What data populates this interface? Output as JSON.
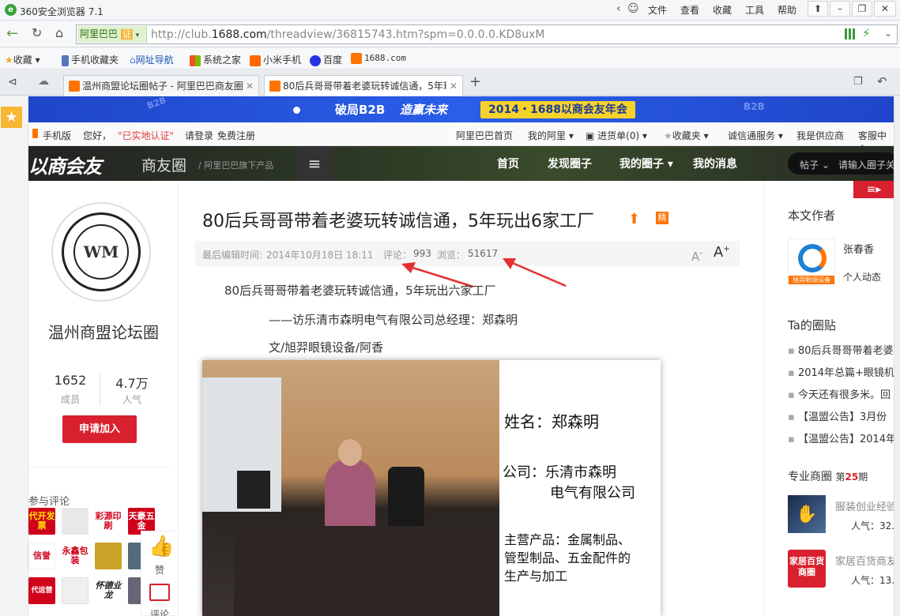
{
  "browser": {
    "title": "360安全浏览器 7.1",
    "menu": [
      "文件",
      "查看",
      "收藏",
      "工具",
      "帮助"
    ],
    "address_prefix": "http://club.",
    "address_domain": "1688.com",
    "address_rest": "/threadview/36815743.htm?spm=0.0.0.0.KD8uxM",
    "site_badge": "阿里巴巴",
    "site_cert": "证",
    "favorites": [
      "收藏",
      "手机收藏夹",
      "网址导航",
      "系统之家",
      "小米手机",
      "百度",
      "1688.com"
    ],
    "tabs": [
      {
        "label": "温州商盟论坛圈帖子 - 阿里巴巴商友圈"
      },
      {
        "label": "80后兵哥哥带着老婆玩转诚信通，5年玩出6家工厂"
      }
    ]
  },
  "banner": {
    "left": "破局B2B",
    "mid": "造赢未来",
    "right": "2014・1688以商会友年会",
    "tag": "B2B"
  },
  "topnav": {
    "mobile": "手机版",
    "hello": "您好，",
    "cert": "\"已实地认证\"",
    "login": "请登录",
    "register": "免费注册",
    "links": [
      "阿里巴巴首页",
      "我的阿里",
      "进货单(0)",
      "收藏夹",
      "诚信通服务",
      "我是供应商",
      "客服中心"
    ]
  },
  "mainnav": {
    "logo": "以商会友",
    "brand": "商友圈",
    "sub": "/ 阿里巴巴旗下产品",
    "links": [
      "首页",
      "发现圈子",
      "我的圈子",
      "我的消息"
    ],
    "search_scope": "帖子",
    "search_placeholder": "请输入圈子关"
  },
  "circle": {
    "name": "温州商盟论坛圈",
    "members": "1652",
    "members_label": "成员",
    "popularity": "4.7万",
    "popularity_label": "人气",
    "join": "申请加入",
    "participants": "参与评论",
    "badges": [
      "代开发票",
      "",
      "彩源印刷",
      "天豪五金",
      "信誉",
      "永鑫包装",
      "",
      "",
      "代运营",
      "",
      "怀德业龙",
      ""
    ]
  },
  "float_actions": {
    "like": "赞",
    "comment": "评论"
  },
  "article": {
    "title": "80后兵哥哥带着老婆玩转诚信通，5年玩出6家工厂",
    "elite": "精",
    "meta_time_label": "最后编辑时间:",
    "meta_time": "2014年10月18日 18:11",
    "comment_label": "评论：",
    "comment_count": "993",
    "view_label": "浏览：",
    "view_count": "51617",
    "font_small": "A",
    "font_large": "A",
    "p1": "80后兵哥哥带着老婆玩转诚信通，5年玩出六家工厂",
    "p2": "——访乐清市森明电气有限公司总经理：郑森明",
    "p3": "文/旭羿眼镜设备/阿香",
    "card": {
      "name": "姓名：郑森明",
      "company1": "公司：乐清市森明",
      "company2": "电气有限公司",
      "products1": "主营产品：金属制品、",
      "products2": "管型制品、五金配件的",
      "products3": "生产与加工"
    }
  },
  "sidebar": {
    "author_title": "本文作者",
    "author_name": "张春香",
    "author_link": "个人动态",
    "author_logo_text": "旭羿眼镜设备",
    "ta_title": "Ta的圈贴",
    "ta_items": [
      "80后兵哥哥带着老婆",
      "2014年总篇+眼镜机",
      "今天还有很多米。回",
      "【温盟公告】3月份",
      "【温盟公告】2014年"
    ],
    "pro_title": "专业商圈",
    "pro_issue_pre": "第",
    "pro_issue": "25",
    "pro_issue_post": "期",
    "pro_items": [
      {
        "name": "服装创业经验",
        "pop": "人气：32."
      },
      {
        "name": "家居百货商友",
        "pop": "人气：13.",
        "logo": "家居百货商圈"
      }
    ]
  }
}
